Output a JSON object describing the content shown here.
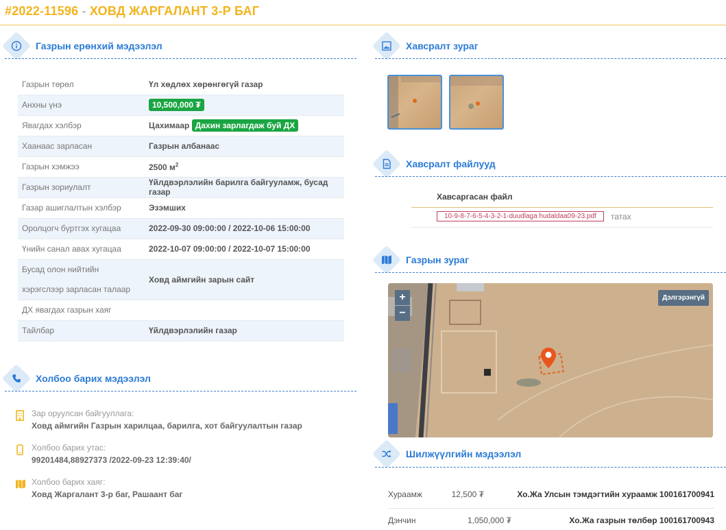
{
  "header": {
    "code": "#2022-11596",
    "separator": "-",
    "title": "ХОВД ЖАРГАЛАНТ 3-Р БАГ"
  },
  "sections": {
    "general": "Газрын ерөнхий мэдээлэл",
    "contact": "Холбоо барих мэдээлэл",
    "images": "Хавсралт зураг",
    "files": "Хавсралт файлууд",
    "map": "Газрын зураг",
    "transfer": "Шилжүүлгийн мэдээлэл"
  },
  "info": {
    "r0": {
      "k": "Газрын төрөл",
      "v": "Үл хөдлөх хөрөнгөгүй газар"
    },
    "r1": {
      "k": "Анхны үнэ",
      "badge": "10,500,000 ₮"
    },
    "r2": {
      "k": "Явагдах хэлбэр",
      "v": "Цахимаар",
      "badge": "Дахин зарлагдаж буй ДХ"
    },
    "r3": {
      "k": "Хаанаас зарласан",
      "v": "Газрын албанаас"
    },
    "r4": {
      "k": "Газрын хэмжээ",
      "v": "2500 м",
      "sup": "2"
    },
    "r5": {
      "k": "Газрын зориулалт",
      "v": "Үйлдвэрлэлийн барилга байгууламж, бусад газар"
    },
    "r6": {
      "k": "Газар ашиглалтын хэлбэр",
      "v": "Эзэмших"
    },
    "r7": {
      "k": "Оролцогч бүртгэх хугацаа",
      "v": "2022-09-30 09:00:00 / 2022-10-06 15:00:00"
    },
    "r8": {
      "k": "Үнийн санал авах хугацаа",
      "v": "2022-10-07 09:00:00 / 2022-10-07 15:00:00"
    },
    "r9": {
      "k": "Бусад олон нийтийн хэрэгслээр зарласан талаар",
      "v": "Ховд аймгийн зарын сайт"
    },
    "r10": {
      "k": "ДХ явагдах газрын хаяг",
      "v": ""
    },
    "r11": {
      "k": "Тайлбар",
      "v": "Үйлдвэрлэлийн газар"
    }
  },
  "contact": {
    "org_label": "Зар оруулсан байгууллага:",
    "org_value": "Ховд аймгийн Газрын харилцаа, барилга, хот байгуулалтын газар",
    "phone_label": "Холбоо барих утас:",
    "phone_value": "99201484,88927373 /2022-09-23 12:39:40/",
    "address_label": "Холбоо барих хаяг:",
    "address_value": "Ховд Жаргалант 3-р баг, Рашаант баг"
  },
  "files": {
    "header": "Хавсаргасан файл",
    "file_name": "10-9-8-7-6-5-4-3-2-1-duudlaga hudaldaa09-23.pdf",
    "download": "татах"
  },
  "map": {
    "zoom_in": "+",
    "zoom_out": "−",
    "more": "Дэлгэрэнгүй"
  },
  "payments": [
    {
      "label": "Хураамж",
      "amount": "12,500 ₮",
      "dest": "Хо.Жа Улсын тэмдэгтийн хураамж 100161700941"
    },
    {
      "label": "Дэнчин",
      "amount": "1,050,000 ₮",
      "dest": "Хо.Жа газрын төлбөр 100161700943"
    }
  ],
  "colors": {
    "title": "#f2b41c",
    "accent": "#2b7bd6",
    "badge_green": "#1aa542",
    "file_red": "#c0405a"
  }
}
